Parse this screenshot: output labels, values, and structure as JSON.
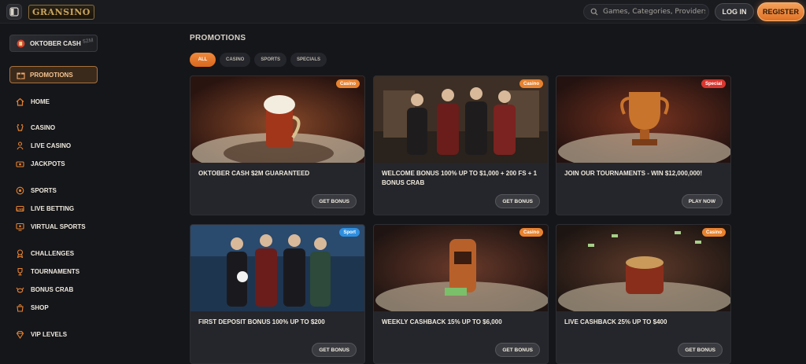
{
  "header": {
    "logo_text": "GRANSINO",
    "search_placeholder": "Games, Categories, Providers",
    "login_label": "LOG IN",
    "register_label": "REGISTER"
  },
  "sidebar": {
    "oktober": {
      "label": "OKTOBER CASH",
      "tag": "$2M"
    },
    "promotions_label": "PROMOTIONS",
    "items": [
      {
        "label": "HOME",
        "icon": "home-icon"
      },
      {
        "label": "CASINO",
        "icon": "casino-icon"
      },
      {
        "label": "LIVE CASINO",
        "icon": "live-casino-icon"
      },
      {
        "label": "JACKPOTS",
        "icon": "jackpots-icon"
      },
      {
        "label": "SPORTS",
        "icon": "sports-icon"
      },
      {
        "label": "LIVE BETTING",
        "icon": "live-betting-icon"
      },
      {
        "label": "VIRTUAL SPORTS",
        "icon": "virtual-sports-icon"
      },
      {
        "label": "CHALLENGES",
        "icon": "challenges-icon"
      },
      {
        "label": "TOURNAMENTS",
        "icon": "tournaments-icon"
      },
      {
        "label": "BONUS CRAB",
        "icon": "bonus-crab-icon"
      },
      {
        "label": "SHOP",
        "icon": "shop-icon"
      },
      {
        "label": "VIP LEVELS",
        "icon": "vip-levels-icon"
      }
    ]
  },
  "main": {
    "title": "PROMOTIONS",
    "filters": [
      "ALL",
      "CASINO",
      "SPORTS",
      "SPECIALS"
    ],
    "cards": [
      {
        "badge": "Casino",
        "badge_color": "#e8822f",
        "title": "OKTOBER CASH $2M GUARANTEED",
        "button": "GET BONUS",
        "art": "beer-mug"
      },
      {
        "badge": "Casino",
        "badge_color": "#e8822f",
        "title": "WELCOME BONUS 100% UP TO $1,000 + 200 FS + 1 BONUS CRAB",
        "button": "GET BONUS",
        "art": "characters-room"
      },
      {
        "badge": "Special",
        "badge_color": "#d9362f",
        "title": "JOIN OUR TOURNAMENTS - WIN $12,000,000!",
        "button": "PLAY NOW",
        "art": "trophy"
      },
      {
        "badge": "Sport",
        "badge_color": "#2f8fe0",
        "title": "FIRST DEPOSIT BONUS 100% UP TO $200",
        "button": "GET BONUS",
        "art": "characters-stadium"
      },
      {
        "badge": "Casino",
        "badge_color": "#e8822f",
        "title": "WEEKLY CASHBACK 15% UP TO $6,000",
        "button": "GET BONUS",
        "art": "slot-machine"
      },
      {
        "badge": "Casino",
        "badge_color": "#e8822f",
        "title": "LIVE CASHBACK 25% UP TO $400",
        "button": "GET BONUS",
        "art": "money-barrel"
      }
    ]
  }
}
